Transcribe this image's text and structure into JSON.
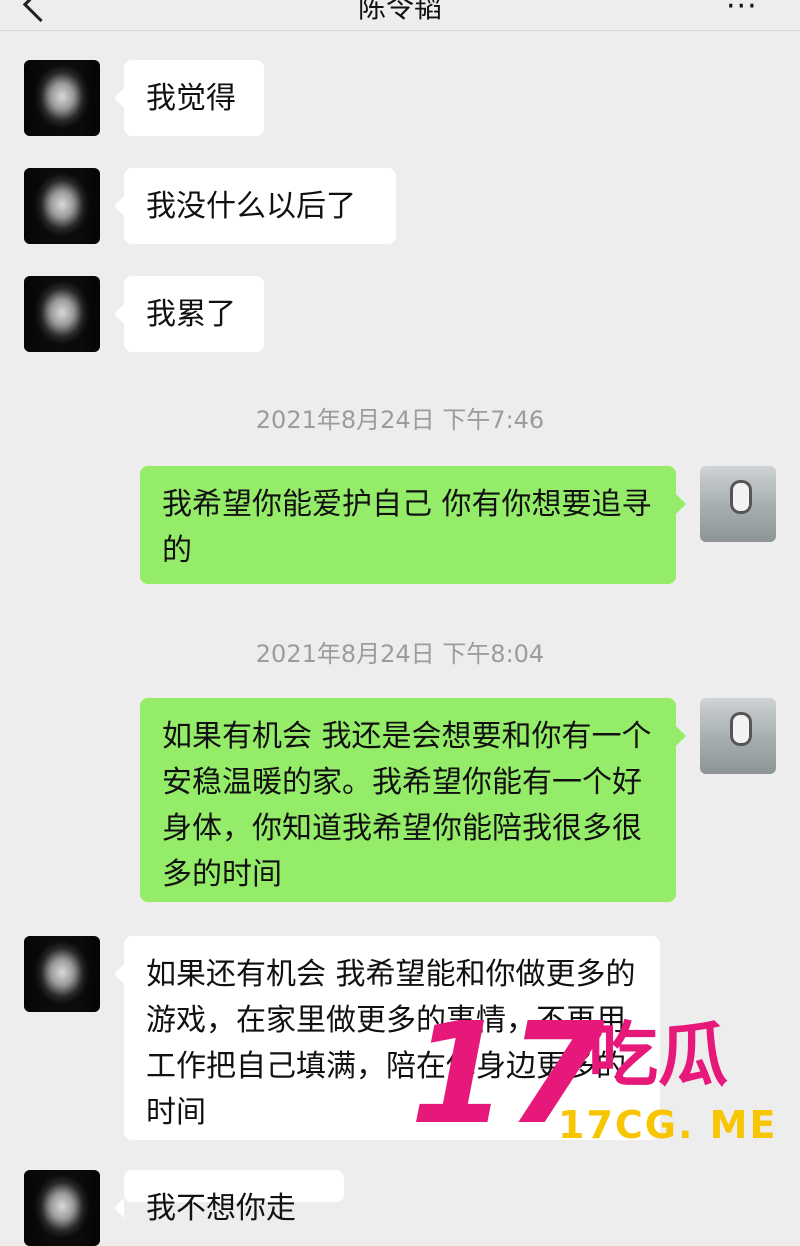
{
  "header": {
    "title": "陈令韬",
    "back_icon": "chevron-left-icon",
    "more_icon": "more-icon"
  },
  "messages": [
    {
      "side": "in",
      "text": "我觉得"
    },
    {
      "side": "in",
      "text": "我没什么以后了"
    },
    {
      "side": "in",
      "text": "我累了"
    },
    {
      "side": "time",
      "text": "2021年8月24日 下午7:46"
    },
    {
      "side": "out",
      "text": "我希望你能爱护自己 你有你想要追寻的"
    },
    {
      "side": "time",
      "text": "2021年8月24日 下午8:04"
    },
    {
      "side": "out",
      "text": "如果有机会 我还是会想要和你有一个安稳温暖的家。我希望你能有一个好身体，你知道我希望你能陪我很多很多的时间"
    },
    {
      "side": "in",
      "text": "如果还有机会 我希望能和你做更多的游戏，在家里做更多的事情，不再用工作把自己填满，陪在你身边更多的时间"
    },
    {
      "side": "in",
      "text": "我不想你走"
    }
  ],
  "watermark": {
    "number": "17",
    "chinese": "吃瓜",
    "url": "17CG. ME"
  },
  "colors": {
    "background": "#ededed",
    "outgoing_bubble": "#95ec69",
    "incoming_bubble": "#ffffff",
    "watermark_pink": "#e6197a",
    "watermark_yellow": "#f7c600"
  }
}
